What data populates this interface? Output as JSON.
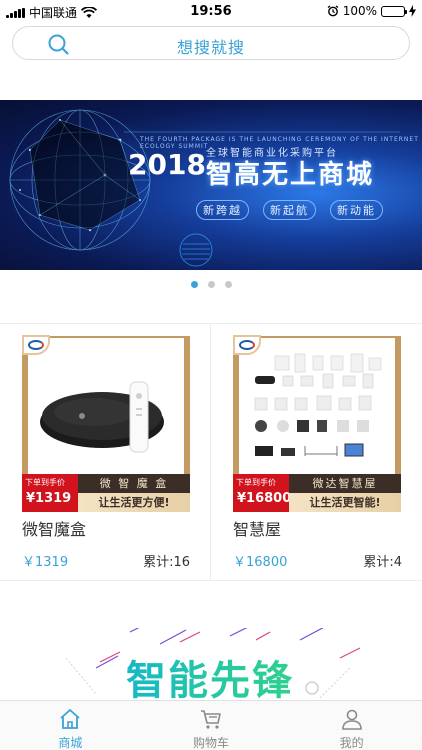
{
  "status_bar": {
    "carrier": "中国联通",
    "time": "19:56",
    "battery": "100%",
    "battery_level": 1.0
  },
  "search": {
    "placeholder": "想搜就搜"
  },
  "banner": {
    "top_text": "THE FOURTH PACKAGE IS THE LAUNCHING CEREMONY OF THE INTERNET ECOLOGY SUMMIT",
    "year": "2018",
    "subtitle": "全球智能商业化采购平台",
    "title": "智高无上商城",
    "tags": [
      "新跨越",
      "新起航",
      "新动能"
    ],
    "dots": 3,
    "active_dot": 0
  },
  "products": [
    {
      "name": "微智魔盒",
      "price": "￥1319",
      "sold": "累计:16",
      "promo_label": "下单到手价",
      "promo_price": "¥1319",
      "band_title": "微 智 魔 盒",
      "band_slogan": "让生活更方便!"
    },
    {
      "name": "智慧屋",
      "price": "￥16800",
      "sold": "累计:4",
      "promo_label": "下单到手价",
      "promo_price": "¥16800",
      "band_title": "微达智慧屋",
      "band_slogan": "让生活更智能!"
    }
  ],
  "promo_banner": {
    "text": "智能先锋"
  },
  "tabbar": {
    "items": [
      {
        "label": "商城",
        "icon": "home-icon",
        "active": true
      },
      {
        "label": "购物车",
        "icon": "cart-icon",
        "active": false
      },
      {
        "label": "我的",
        "icon": "user-icon",
        "active": false
      }
    ]
  },
  "colors": {
    "accent": "#3aa2d6",
    "promo_red": "#d1131e",
    "frame_gold": "#c49a63"
  }
}
